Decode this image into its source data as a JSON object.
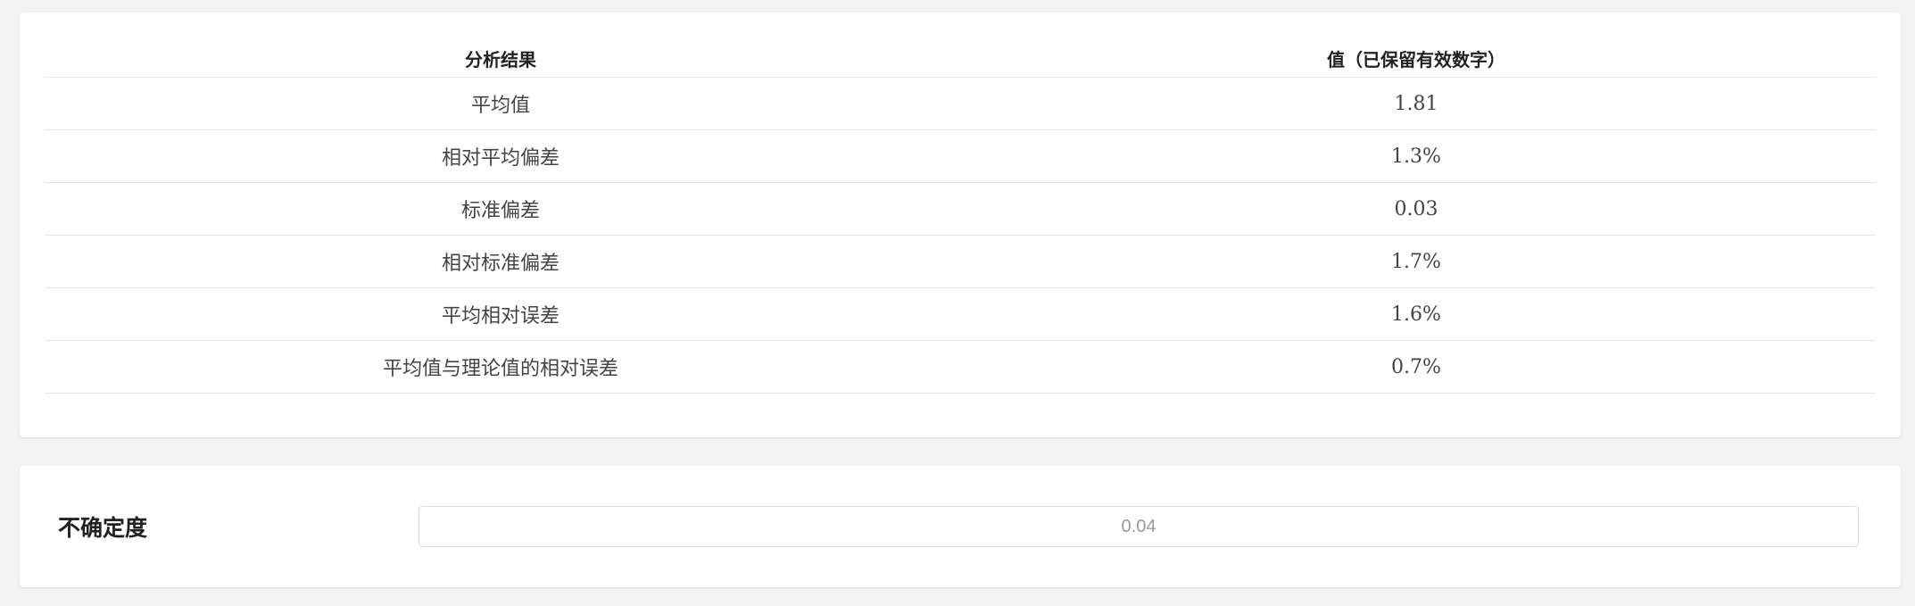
{
  "results_table": {
    "headers": [
      "分析结果",
      "值（已保留有效数字）"
    ],
    "rows": [
      {
        "label": "平均值",
        "value": "1.81"
      },
      {
        "label": "相对平均偏差",
        "value": "1.3%"
      },
      {
        "label": "标准偏差",
        "value": "0.03"
      },
      {
        "label": "相对标准偏差",
        "value": "1.7%"
      },
      {
        "label": "平均相对误差",
        "value": "1.6%"
      },
      {
        "label": "平均值与理论值的相对误差",
        "value": "0.7%"
      }
    ]
  },
  "uncertainty": {
    "label": "不确定度",
    "value": "0.04"
  }
}
